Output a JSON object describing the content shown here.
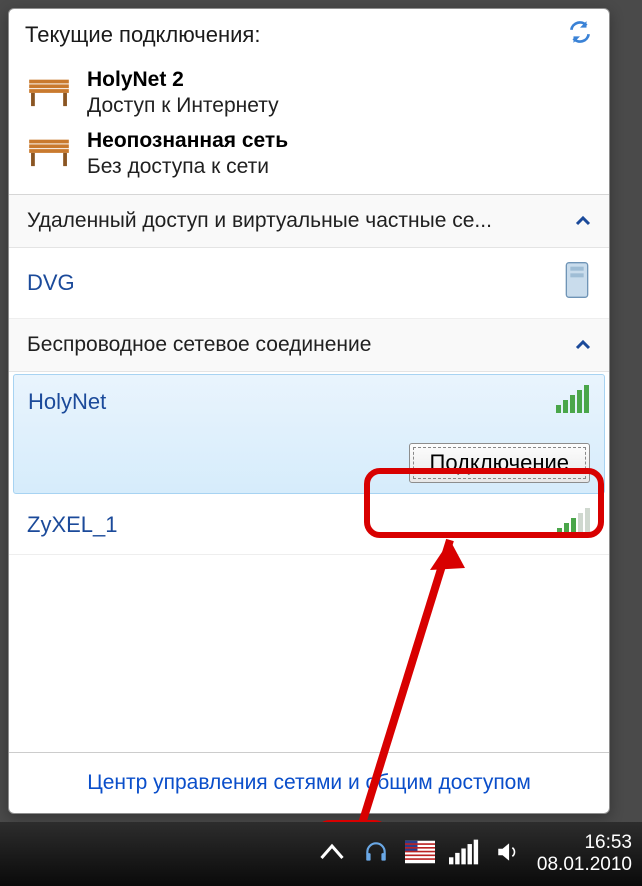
{
  "header": {
    "title": "Текущие подключения:"
  },
  "connections": [
    {
      "name": "HolyNet  2",
      "status": "Доступ к Интернету"
    },
    {
      "name": "Неопознанная сеть",
      "status": "Без доступа к сети"
    }
  ],
  "sections": {
    "dialup": {
      "title": "Удаленный доступ и виртуальные частные се...",
      "items": [
        {
          "name": "DVG"
        }
      ]
    },
    "wireless": {
      "title": "Беспроводное сетевое соединение",
      "items": [
        {
          "name": "HolyNet",
          "signal": 5,
          "selected": true
        },
        {
          "name": "ZyXEL_1",
          "signal": 3,
          "selected": false
        }
      ]
    }
  },
  "connect_button": "Подключение",
  "footer_link": "Центр управления сетями и общим доступом",
  "taskbar": {
    "time": "16:53",
    "date": "08.01.2010"
  }
}
